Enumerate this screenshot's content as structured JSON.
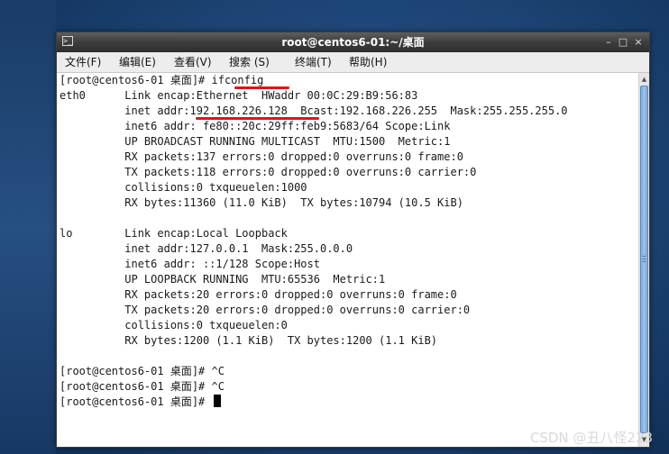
{
  "window": {
    "title": "root@centos6-01:~/桌面",
    "controls": {
      "minimize": "–",
      "maximize": "□",
      "close": "×"
    }
  },
  "menubar": {
    "items": [
      {
        "label": "文件(F)"
      },
      {
        "label": "编辑(E)"
      },
      {
        "label": "查看(V)"
      },
      {
        "label": "搜索 (S)"
      },
      {
        "label": "终端(T)"
      },
      {
        "label": "帮助(H)"
      }
    ]
  },
  "terminal": {
    "lines": [
      "[root@centos6-01 桌面]# ifconfig",
      "eth0      Link encap:Ethernet  HWaddr 00:0C:29:B9:56:83",
      "          inet addr:192.168.226.128  Bcast:192.168.226.255  Mask:255.255.255.0",
      "          inet6 addr: fe80::20c:29ff:feb9:5683/64 Scope:Link",
      "          UP BROADCAST RUNNING MULTICAST  MTU:1500  Metric:1",
      "          RX packets:137 errors:0 dropped:0 overruns:0 frame:0",
      "          TX packets:118 errors:0 dropped:0 overruns:0 carrier:0",
      "          collisions:0 txqueuelen:1000",
      "          RX bytes:11360 (11.0 KiB)  TX bytes:10794 (10.5 KiB)",
      "",
      "lo        Link encap:Local Loopback",
      "          inet addr:127.0.0.1  Mask:255.0.0.0",
      "          inet6 addr: ::1/128 Scope:Host",
      "          UP LOOPBACK RUNNING  MTU:65536  Metric:1",
      "          RX packets:20 errors:0 dropped:0 overruns:0 frame:0",
      "          TX packets:20 errors:0 dropped:0 overruns:0 carrier:0",
      "          collisions:0 txqueuelen:0",
      "          RX bytes:1200 (1.1 KiB)  TX bytes:1200 (1.1 KiB)",
      "",
      "[root@centos6-01 桌面]# ^C",
      "[root@centos6-01 桌面]# ^C",
      "[root@centos6-01 桌面]# "
    ]
  },
  "watermark": "CSDN @丑八怪223",
  "colors": {
    "annotation": "#e01414",
    "titlebar": "#3d3d3d",
    "scroll_thumb": "#8fb5e2"
  },
  "icons": {
    "window": "terminal-icon"
  }
}
